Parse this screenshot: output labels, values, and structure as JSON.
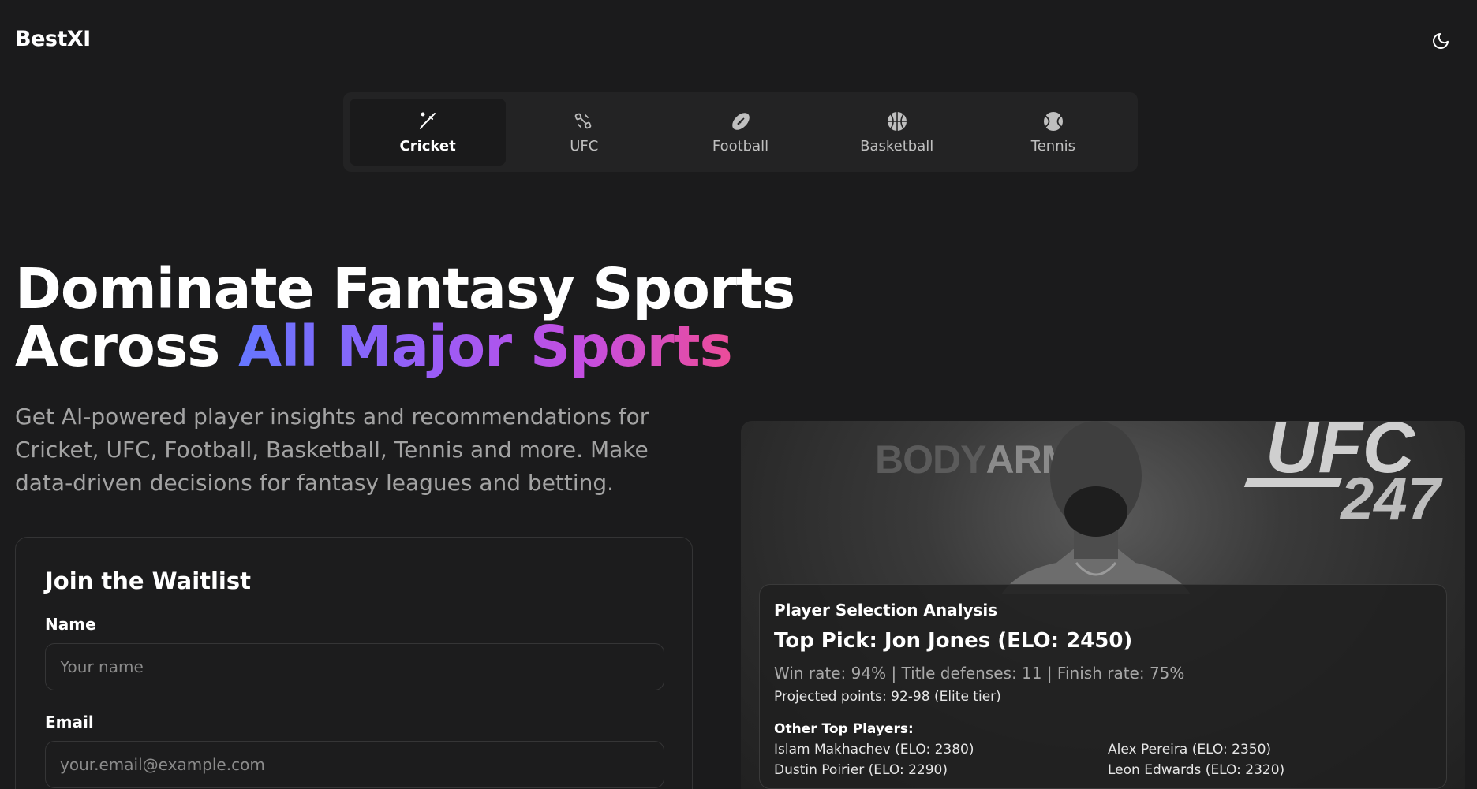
{
  "brand": "BestXI",
  "theme_toggle_icon": "moon-icon",
  "tabs": [
    {
      "label": "Cricket",
      "icon": "cricket-bat-icon",
      "active": true
    },
    {
      "label": "UFC",
      "icon": "dumbbell-icon",
      "active": false
    },
    {
      "label": "Football",
      "icon": "american-football-icon",
      "active": false
    },
    {
      "label": "Basketball",
      "icon": "basketball-icon",
      "active": false
    },
    {
      "label": "Tennis",
      "icon": "tennis-ball-icon",
      "active": false
    }
  ],
  "hero": {
    "line1": "Dominate Fantasy Sports",
    "line2_plain": "Across ",
    "line2_gradient": "All Major Sports",
    "subtitle": "Get AI-powered player insights and recommendations for Cricket, UFC, Football, Basketball, Tennis and more. Make data-driven decisions for fantasy leagues and betting.",
    "gradient_colors": [
      "#6677ff",
      "#9b5cf6",
      "#c44ee0",
      "#ec4c99"
    ]
  },
  "waitlist": {
    "title": "Join the Waitlist",
    "name_label": "Name",
    "name_placeholder": "Your name",
    "email_label": "Email",
    "email_placeholder": "your.email@example.com"
  },
  "image": {
    "sponsor_text_dim": "BODY",
    "sponsor_text_bright": "ARMO",
    "event_text": "UFC",
    "event_number": "247"
  },
  "analysis": {
    "title": "Player Selection Analysis",
    "top_pick": "Top Pick: Jon Jones (ELO: 2450)",
    "stats": "Win rate: 94% | Title defenses: 11 | Finish rate: 75%",
    "projected": "Projected points: 92-98 (Elite tier)",
    "other_title": "Other Top Players:",
    "players": [
      "Islam Makhachev (ELO: 2380)",
      "Alex Pereira (ELO: 2350)",
      "Dustin Poirier (ELO: 2290)",
      "Leon Edwards (ELO: 2320)"
    ]
  }
}
